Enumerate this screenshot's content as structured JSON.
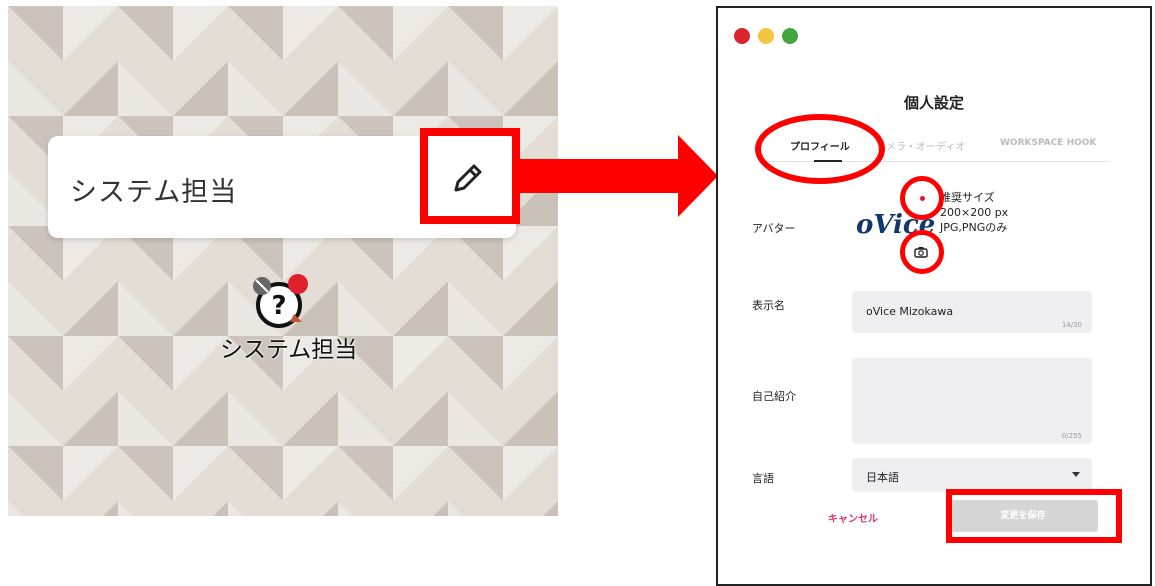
{
  "left_panel": {
    "card_name": "システム担当",
    "avatar_name": "システム担当"
  },
  "settings": {
    "title": "個人設定",
    "tabs": [
      {
        "label": "プロフィール",
        "active": true
      },
      {
        "label": "カメラ・オーディオ",
        "active": false
      },
      {
        "label": "WORKSPACE HOOK",
        "active": false
      }
    ],
    "avatar": {
      "label": "アバター",
      "logo_text": "oVice",
      "info": [
        "推奨サイズ",
        "200×200 px",
        "JPG,PNGのみ"
      ]
    },
    "display_name": {
      "label": "表示名",
      "value": "oVice Mizokawa",
      "counter": "14/30"
    },
    "bio": {
      "label": "自己紹介",
      "value": "",
      "counter": "0/255"
    },
    "language": {
      "label": "言語",
      "value": "日本語"
    },
    "cancel_label": "キャンセル",
    "save_label": "変更を保存"
  },
  "colors": {
    "highlight": "#ff0000",
    "cancel": "#e0356f",
    "logo": "#14376b"
  }
}
